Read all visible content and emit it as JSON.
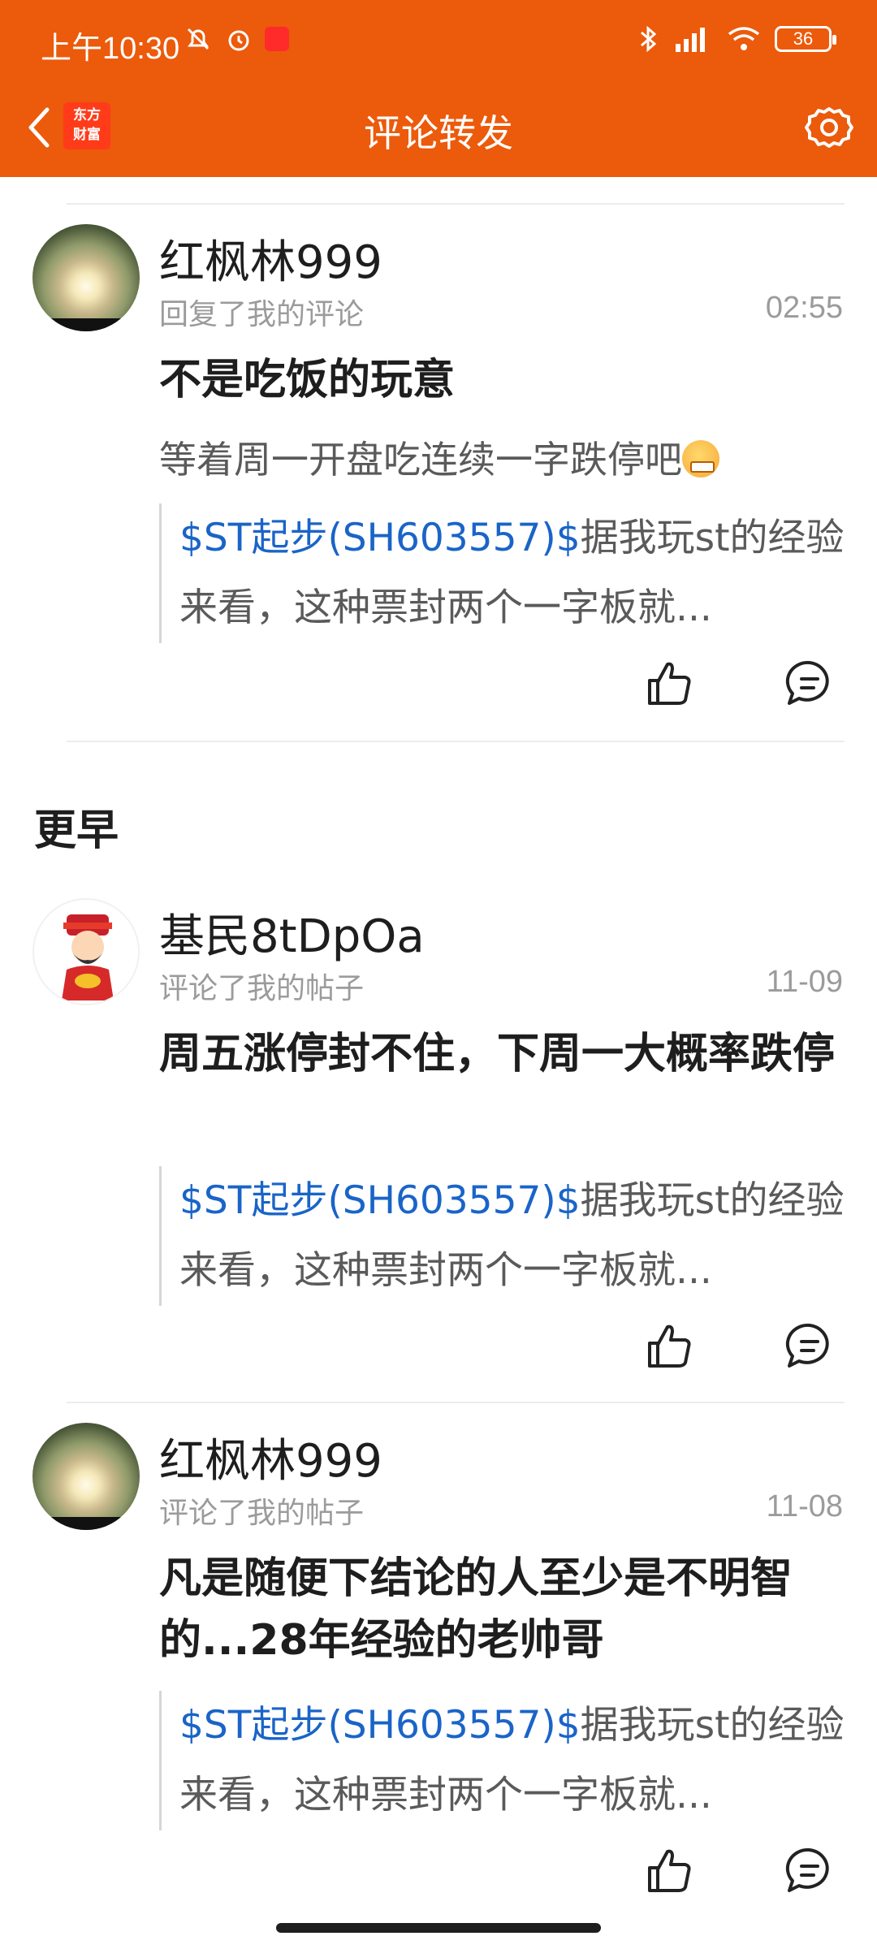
{
  "status_bar": {
    "time": "上午10:30",
    "battery": "36"
  },
  "header": {
    "logo_text_top": "东方",
    "logo_text_bottom": "财富",
    "title": "评论转发"
  },
  "section_label": "更早",
  "items": [
    {
      "name": "红枫林999",
      "action": "回复了我的评论",
      "time": "02:55",
      "headline": "不是吃饭的玩意",
      "subtext": "等着周一开盘吃连续一字跌停吧",
      "quote_link": "$ST起步(SH603557)$",
      "quote_text": "据我玩st的经验来看，这种票封两个一字板就..."
    },
    {
      "name": "基民8tDpOa",
      "action": "评论了我的帖子",
      "time": "11-09",
      "headline": "周五涨停封不住，下周一大概率跌停",
      "quote_link": "$ST起步(SH603557)$",
      "quote_text": "据我玩st的经验来看，这种票封两个一字板就..."
    },
    {
      "name": "红枫林999",
      "action": "评论了我的帖子",
      "time": "11-08",
      "headline": "凡是随便下结论的人至少是不明智的...28年经验的老帅哥",
      "quote_link": "$ST起步(SH603557)$",
      "quote_text": "据我玩st的经验来看，这种票封两个一字板就..."
    }
  ],
  "colors": {
    "header_bg": "#ec5a0b",
    "link": "#1a64c8"
  }
}
